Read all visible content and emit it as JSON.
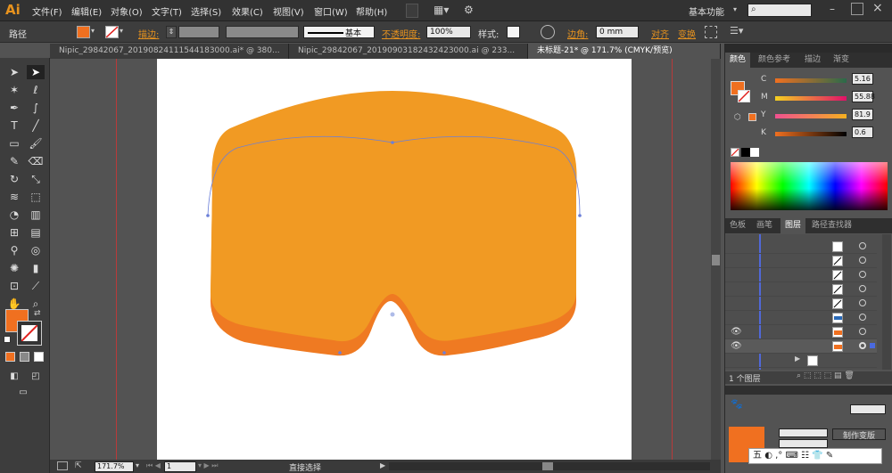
{
  "app": {
    "logo": "Ai"
  },
  "menu": {
    "items": [
      "文件(F)",
      "编辑(E)",
      "对象(O)",
      "文字(T)",
      "选择(S)",
      "效果(C)",
      "视图(V)",
      "窗口(W)",
      "帮助(H)"
    ],
    "workspace": "基本功能"
  },
  "control": {
    "selection_label": "路径",
    "stroke_label": "描边:",
    "brush_label": "基本",
    "opacity_label": "不透明度:",
    "opacity_value": "100%",
    "style_label": "样式:",
    "corner_label": "边角:",
    "corner_value": "0 mm",
    "align_label": "对齐",
    "transform_label": "变换",
    "fill_color": "#f07020"
  },
  "tabs": [
    {
      "label": "Nipic_29842067_20190824111544183000.ai* @ 380...",
      "active": false
    },
    {
      "label": "Nipic_29842067_20190903182432423000.ai @ 233...",
      "active": false
    },
    {
      "label": "未标题-21* @ 171.7% (CMYK/预览)",
      "active": true
    }
  ],
  "color_panel": {
    "tabs": [
      "颜色",
      "颜色参考",
      "描边",
      "渐变"
    ],
    "channels": [
      {
        "name": "C",
        "value": "5.16",
        "pos": 0.05
      },
      {
        "name": "M",
        "value": "55.88",
        "pos": 0.56
      },
      {
        "name": "Y",
        "value": "81.9",
        "pos": 0.82
      },
      {
        "name": "K",
        "value": "0.6",
        "pos": 0.01
      }
    ]
  },
  "layers_panel": {
    "tabs": [
      "色板",
      "画笔",
      "图层",
      "路径查找器"
    ],
    "footer": "1 个图层"
  },
  "status": {
    "zoom": "171.7%",
    "page": "1",
    "tool": "直接选择"
  },
  "art": {
    "top_color": "#f19a23",
    "bottom_color": "#ef7a22"
  },
  "bottom_panel": {
    "button": "制作变版",
    "ime": "五"
  }
}
